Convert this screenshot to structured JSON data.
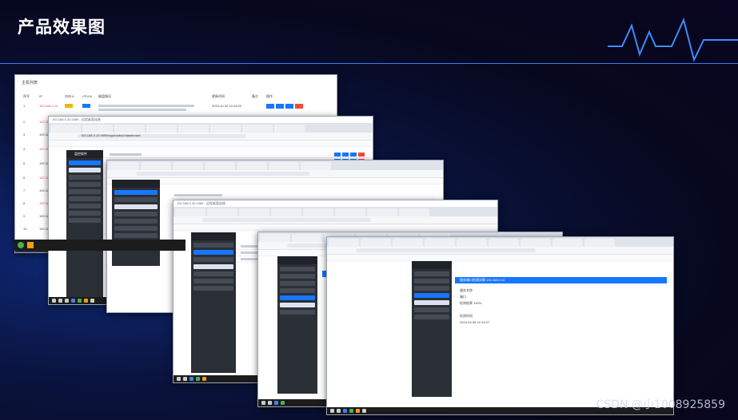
{
  "slide": {
    "title": "产品效果图",
    "watermark": "CSDN @小1008925859",
    "accent": "#3d7cf0"
  },
  "screens": {
    "host_list": {
      "title": "主机列表",
      "columns": [
        "序号",
        "IP",
        "内存%",
        "CPU%",
        "磁盘情况",
        "更新时间",
        "备注",
        "操作"
      ],
      "rows": [
        {
          "no": "1",
          "ip": "192.168.0.10",
          "time": "2023-10-30 10:16:22"
        },
        {
          "no": "2",
          "ip": "192.168.0.11",
          "time": ""
        },
        {
          "no": "3",
          "ip": "192.168.0.12",
          "time": ""
        },
        {
          "no": "4",
          "ip": "192.168.0.13",
          "time": ""
        },
        {
          "no": "5",
          "ip": "192.168.0.14",
          "time": ""
        },
        {
          "no": "6",
          "ip": "192.168.0.15",
          "time": ""
        },
        {
          "no": "7",
          "ip": "192.168.0.16",
          "time": ""
        },
        {
          "no": "8",
          "ip": "192.168.0.17",
          "time": ""
        },
        {
          "no": "9",
          "ip": "192.168.0.18",
          "time": ""
        },
        {
          "no": "10",
          "ip": "192.168.0.19",
          "time": ""
        }
      ]
    },
    "browser": {
      "address": "192.168.0.10:9999/wgclouds/#/dashboard",
      "remote_title": "192.168.0.32:1989 - 远程桌面连接"
    },
    "sidebar": {
      "brand": "监控软件",
      "items": [
        "主机管理",
        "主机列表",
        "数据库管理",
        "数据表管理",
        "服务端口检测",
        "系统设置",
        "邮件设置",
        "日志查看"
      ]
    },
    "detail": {
      "banner": "服务端口检测详情 192.168.0.10",
      "fields": [
        "服务名称",
        "端口",
        "检测结果 100%",
        "检测时间",
        "2024-04-08 10:15:27"
      ]
    }
  }
}
